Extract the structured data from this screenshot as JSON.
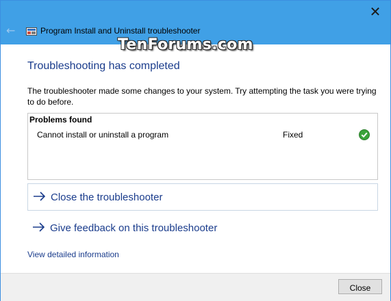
{
  "window": {
    "title": "Program Install and Uninstall troubleshooter",
    "watermark": "TenForums.com"
  },
  "icons": {
    "close": "close-icon",
    "back": "back-arrow-icon",
    "app": "troubleshooter-app-icon",
    "check": "green-check-icon",
    "link_arrow": "arrow-right-icon"
  },
  "main": {
    "heading": "Troubleshooting has completed",
    "description": "The troubleshooter made some changes to your system. Try attempting the task you were trying to do before.",
    "problems": {
      "header": "Problems found",
      "items": [
        {
          "name": "Cannot install or uninstall a program",
          "status": "Fixed"
        }
      ]
    },
    "actions": [
      {
        "label": "Close the troubleshooter"
      },
      {
        "label": "Give feedback on this troubleshooter"
      }
    ],
    "detail_link": "View detailed information"
  },
  "footer": {
    "close_label": "Close"
  },
  "colors": {
    "titlebar": "#40a0e6",
    "heading": "#1a3c8c",
    "link": "#1a3c8c",
    "check": "#3aa33a"
  }
}
